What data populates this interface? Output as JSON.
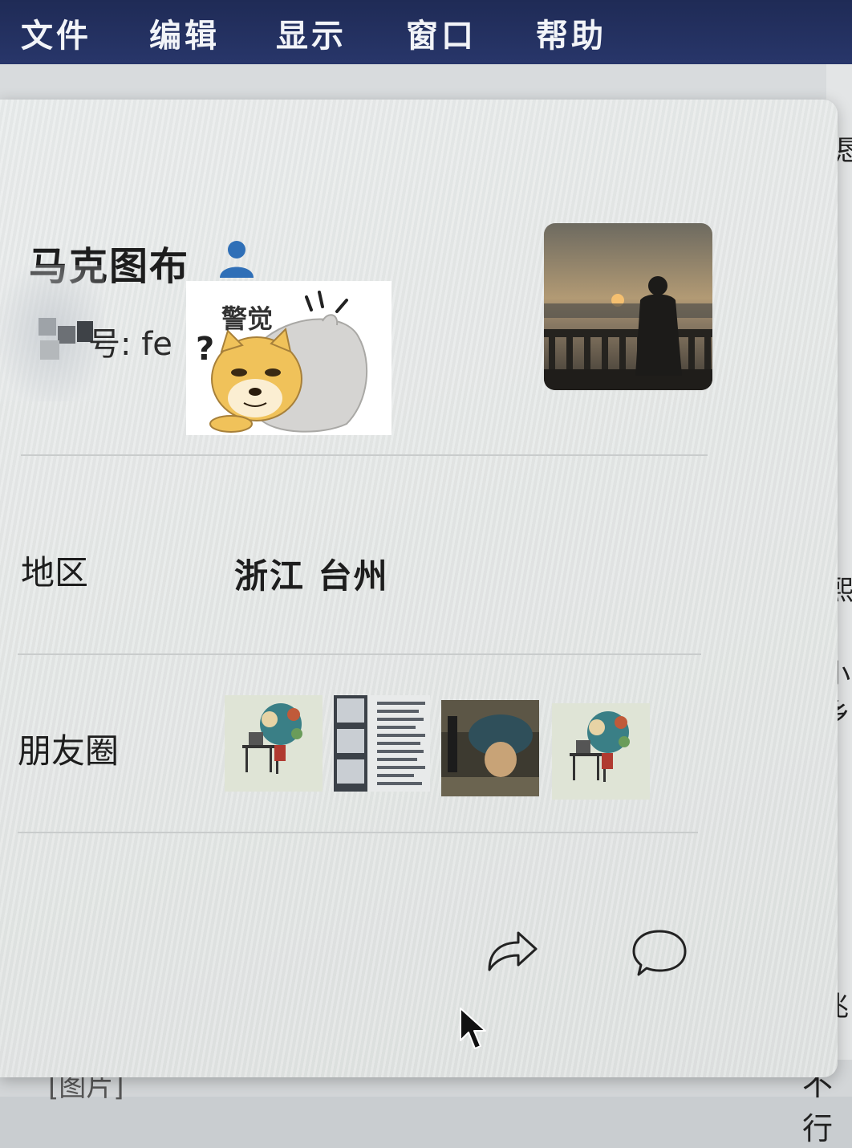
{
  "menubar": {
    "items": [
      {
        "label": "文件"
      },
      {
        "label": "编辑"
      },
      {
        "label": "显示"
      },
      {
        "label": "窗口"
      },
      {
        "label": "帮助"
      }
    ]
  },
  "profile": {
    "name": "马克图布",
    "wechat_id_label": "号: fe",
    "sticker_text": "警觉",
    "sticker_question": "?"
  },
  "region": {
    "label": "地区",
    "value": "浙江 台州"
  },
  "moments": {
    "label": "朋友圈",
    "thumbnails": [
      "thumb-1",
      "thumb-2",
      "thumb-3",
      "thumb-4"
    ]
  },
  "actions": {
    "share_icon": "share-arrow-icon",
    "message_icon": "chat-bubble-icon"
  },
  "background": {
    "bottom_label": "[图片]",
    "bottom_right": "不行",
    "right_fragments": [
      "恳",
      "熙",
      "小乡",
      "兆"
    ]
  }
}
